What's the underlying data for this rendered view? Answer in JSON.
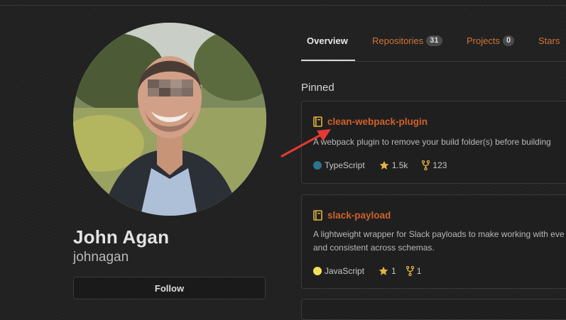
{
  "profile": {
    "name": "John Agan",
    "login": "johnagan",
    "follow_label": "Follow"
  },
  "tabs": [
    {
      "label": "Overview",
      "active": true
    },
    {
      "label": "Repositories",
      "count": "31"
    },
    {
      "label": "Projects",
      "count": "0"
    },
    {
      "label": "Stars"
    }
  ],
  "pinned": {
    "title": "Pinned",
    "repos": [
      {
        "name": "clean-webpack-plugin",
        "description": "A webpack plugin to remove your build folder(s) before building",
        "language": "TypeScript",
        "language_color": "#2b7489",
        "stars": "1.5k",
        "forks": "123"
      },
      {
        "name": "slack-payload",
        "description_line1": "A lightweight wrapper for Slack payloads to make working with eve",
        "description_line2": "and consistent across schemas.",
        "language": "JavaScript",
        "language_color": "#f1e05a",
        "stars": "1",
        "forks": "1"
      }
    ]
  },
  "colors": {
    "link": "#d0612b",
    "annotation_arrow": "#e53935",
    "icon_yellow": "#e3b341"
  },
  "icons": [
    "repo-book-icon",
    "star-icon",
    "fork-icon",
    "annotation-arrow"
  ]
}
